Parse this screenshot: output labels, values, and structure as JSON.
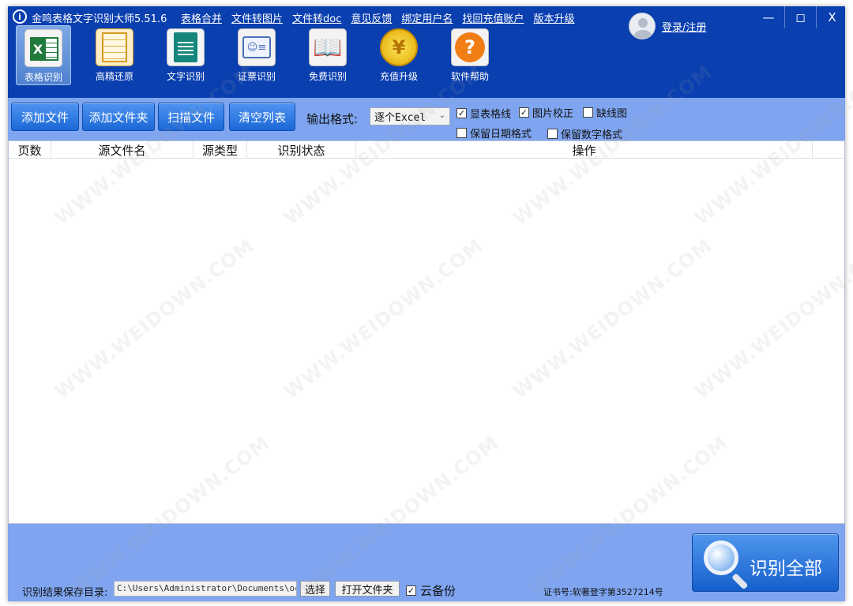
{
  "app": {
    "logo_glyph": "i",
    "title": "金鸣表格文字识别大师5.51.6"
  },
  "top_links": [
    "表格合并",
    "文件转图片",
    "文件转doc",
    "意见反馈",
    "绑定用户名",
    "找回充值账户",
    "版本升级"
  ],
  "user": {
    "login_label": "登录/注册"
  },
  "window_controls": {
    "minimize": "—",
    "maximize": "◻",
    "close": "X"
  },
  "tools": [
    {
      "label": "表格识别",
      "icon": "excel-icon",
      "active": true
    },
    {
      "label": "高精还原",
      "icon": "document-restore-icon"
    },
    {
      "label": "文字识别",
      "icon": "text-document-icon"
    },
    {
      "label": "证票识别",
      "icon": "id-card-icon"
    },
    {
      "label": "免费识别",
      "icon": "owl-book-icon"
    },
    {
      "label": "充值升级",
      "icon": "yuan-coin-icon",
      "icon_glyph": "¥"
    },
    {
      "label": "软件帮助",
      "icon": "help-icon",
      "icon_glyph": "?"
    }
  ],
  "toolbar": {
    "add_file": "添加文件",
    "add_folder": "添加文件夹",
    "scan_file": "扫描文件",
    "clear_list": "清空列表",
    "format_label": "输出格式:",
    "format_value": "逐个Excel",
    "options": [
      {
        "label": "显表格线",
        "checked": true
      },
      {
        "label": "图片校正",
        "checked": true
      },
      {
        "label": "缺线图",
        "checked": false
      },
      {
        "label": "保留日期格式",
        "checked": false
      },
      {
        "label": "保留数字格式",
        "checked": false
      }
    ]
  },
  "table": {
    "columns": [
      "页数",
      "源文件名",
      "源类型",
      "识别状态",
      "操作"
    ],
    "rows": []
  },
  "watermark": "WWW.WEIDOWN.COM",
  "bottom": {
    "save_dir_label": "识别结果保存目录:",
    "save_dir_value": "C:\\Users\\Administrator\\Documents\\ocr",
    "choose_button": "选择",
    "open_folder_button": "打开文件夹",
    "cloud_backup_label": "云备份",
    "cloud_backup_checked": true,
    "certificate": "证书号:软著登字第3527214号",
    "recognize_all": "识别全部"
  },
  "colors": {
    "titlebar": "#0a3fb0",
    "panel": "#7fa5f0",
    "button": "#1b67d6"
  }
}
